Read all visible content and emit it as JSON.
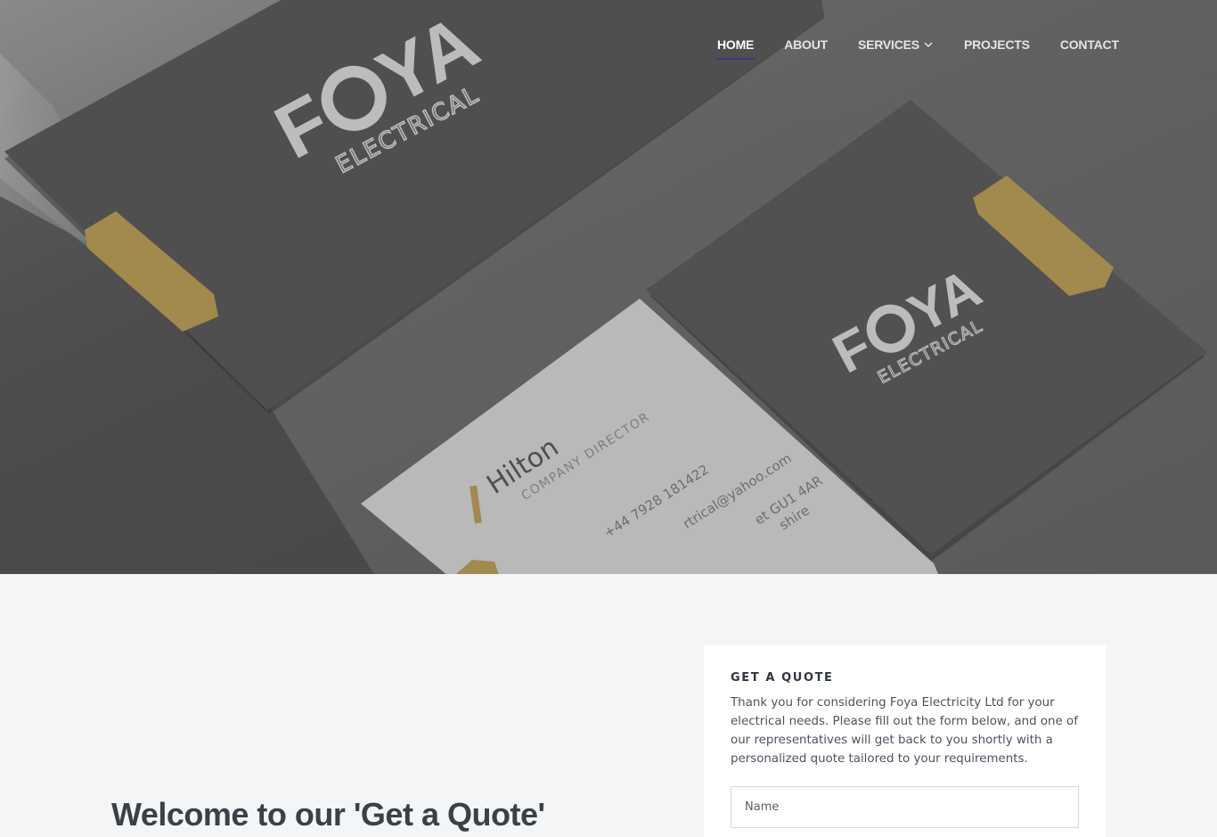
{
  "nav": {
    "items": [
      {
        "label": "HOME",
        "active": true
      },
      {
        "label": "ABOUT",
        "active": false
      },
      {
        "label": "SERVICES",
        "active": false,
        "has_dropdown": true
      },
      {
        "label": "PROJECTS",
        "active": false
      },
      {
        "label": "CONTACT",
        "active": false
      }
    ]
  },
  "hero": {
    "brand": "FOYA",
    "brand_sub": "ELECTRICAL",
    "card_name": "Hilton",
    "card_role": "COMPANY DIRECTOR",
    "card_phone": "+44 7928 181422",
    "card_email": "rtrical@yahoo.com",
    "card_address": "et GU1 4AR",
    "card_address2": "shire"
  },
  "main": {
    "welcome": "Welcome to our 'Get a Quote'"
  },
  "quote": {
    "title": "GET A QUOTE",
    "text": "Thank you for considering Foya Electricity Ltd for your electrical needs. Please fill out the form below, and one of our representatives will get back to you shortly with a personalized quote tailored to your requirements.",
    "name_placeholder": "Name"
  },
  "colors": {
    "accent": "#3d3a8f",
    "gold": "#b79b50",
    "card_dark": "#585858",
    "card_light": "#cfcfcf"
  }
}
